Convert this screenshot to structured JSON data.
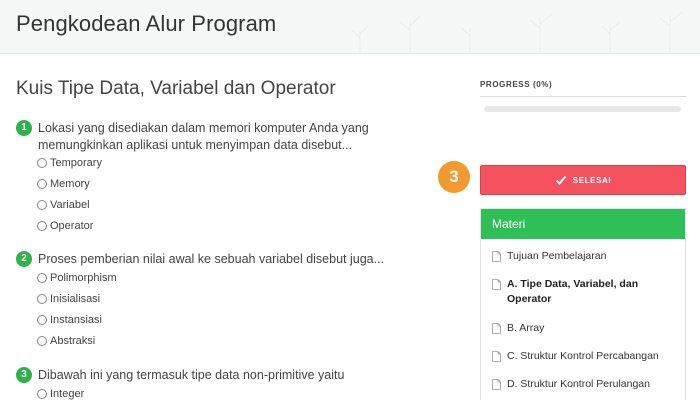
{
  "header": {
    "title": "Pengkodean Alur Program"
  },
  "quiz": {
    "title": "Kuis Tipe Data, Variabel dan Operator",
    "questions": [
      {
        "number": "1",
        "text": "Lokasi yang disediakan dalam memori komputer Anda yang memungkinkan aplikasi untuk menyimpan data disebut...",
        "options": [
          "Temporary",
          "Memory",
          "Variabel",
          "Operator"
        ]
      },
      {
        "number": "2",
        "text": "Proses pemberian nilai awal ke sebuah variabel disebut juga...",
        "options": [
          "Polimorphism",
          "Inisialisasi",
          "Instansiasi",
          "Abstraksi"
        ]
      },
      {
        "number": "3",
        "text": "Dibawah ini yang termasuk tipe data non-primitive yaitu",
        "options": [
          "Integer"
        ]
      }
    ]
  },
  "progress": {
    "label": "PROGRESS (0%)",
    "value": 0
  },
  "step_badge": "3",
  "finish_button": {
    "label": "SELESAI",
    "icon": "check-icon"
  },
  "materi": {
    "title": "Materi",
    "items": [
      {
        "label": "Tujuan Pembelajaran",
        "active": false
      },
      {
        "label": "A. Tipe Data, Variabel, dan Operator",
        "active": true
      },
      {
        "label": "B. Array",
        "active": false
      },
      {
        "label": "C. Struktur Kontrol Percabangan",
        "active": false
      },
      {
        "label": "D. Struktur Kontrol Perulangan",
        "active": false
      }
    ]
  },
  "colors": {
    "accent_green": "#2db34a",
    "finish_red": "#f5515f",
    "badge_orange": "#f29a2e",
    "panel_green": "#2fbf57"
  }
}
